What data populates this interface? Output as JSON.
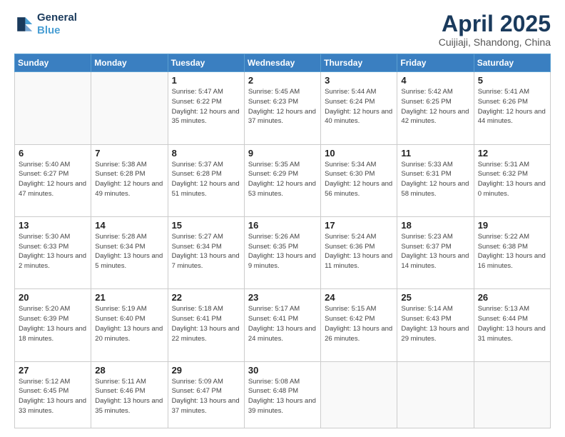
{
  "logo": {
    "line1": "General",
    "line2": "Blue"
  },
  "title": "April 2025",
  "location": "Cuijiaji, Shandong, China",
  "days_of_week": [
    "Sunday",
    "Monday",
    "Tuesday",
    "Wednesday",
    "Thursday",
    "Friday",
    "Saturday"
  ],
  "weeks": [
    [
      {
        "day": "",
        "empty": true
      },
      {
        "day": "",
        "empty": true
      },
      {
        "day": "1",
        "sunrise": "5:47 AM",
        "sunset": "6:22 PM",
        "daylight": "12 hours and 35 minutes."
      },
      {
        "day": "2",
        "sunrise": "5:45 AM",
        "sunset": "6:23 PM",
        "daylight": "12 hours and 37 minutes."
      },
      {
        "day": "3",
        "sunrise": "5:44 AM",
        "sunset": "6:24 PM",
        "daylight": "12 hours and 40 minutes."
      },
      {
        "day": "4",
        "sunrise": "5:42 AM",
        "sunset": "6:25 PM",
        "daylight": "12 hours and 42 minutes."
      },
      {
        "day": "5",
        "sunrise": "5:41 AM",
        "sunset": "6:26 PM",
        "daylight": "12 hours and 44 minutes."
      }
    ],
    [
      {
        "day": "6",
        "sunrise": "5:40 AM",
        "sunset": "6:27 PM",
        "daylight": "12 hours and 47 minutes."
      },
      {
        "day": "7",
        "sunrise": "5:38 AM",
        "sunset": "6:28 PM",
        "daylight": "12 hours and 49 minutes."
      },
      {
        "day": "8",
        "sunrise": "5:37 AM",
        "sunset": "6:28 PM",
        "daylight": "12 hours and 51 minutes."
      },
      {
        "day": "9",
        "sunrise": "5:35 AM",
        "sunset": "6:29 PM",
        "daylight": "12 hours and 53 minutes."
      },
      {
        "day": "10",
        "sunrise": "5:34 AM",
        "sunset": "6:30 PM",
        "daylight": "12 hours and 56 minutes."
      },
      {
        "day": "11",
        "sunrise": "5:33 AM",
        "sunset": "6:31 PM",
        "daylight": "12 hours and 58 minutes."
      },
      {
        "day": "12",
        "sunrise": "5:31 AM",
        "sunset": "6:32 PM",
        "daylight": "13 hours and 0 minutes."
      }
    ],
    [
      {
        "day": "13",
        "sunrise": "5:30 AM",
        "sunset": "6:33 PM",
        "daylight": "13 hours and 2 minutes."
      },
      {
        "day": "14",
        "sunrise": "5:28 AM",
        "sunset": "6:34 PM",
        "daylight": "13 hours and 5 minutes."
      },
      {
        "day": "15",
        "sunrise": "5:27 AM",
        "sunset": "6:34 PM",
        "daylight": "13 hours and 7 minutes."
      },
      {
        "day": "16",
        "sunrise": "5:26 AM",
        "sunset": "6:35 PM",
        "daylight": "13 hours and 9 minutes."
      },
      {
        "day": "17",
        "sunrise": "5:24 AM",
        "sunset": "6:36 PM",
        "daylight": "13 hours and 11 minutes."
      },
      {
        "day": "18",
        "sunrise": "5:23 AM",
        "sunset": "6:37 PM",
        "daylight": "13 hours and 14 minutes."
      },
      {
        "day": "19",
        "sunrise": "5:22 AM",
        "sunset": "6:38 PM",
        "daylight": "13 hours and 16 minutes."
      }
    ],
    [
      {
        "day": "20",
        "sunrise": "5:20 AM",
        "sunset": "6:39 PM",
        "daylight": "13 hours and 18 minutes."
      },
      {
        "day": "21",
        "sunrise": "5:19 AM",
        "sunset": "6:40 PM",
        "daylight": "13 hours and 20 minutes."
      },
      {
        "day": "22",
        "sunrise": "5:18 AM",
        "sunset": "6:41 PM",
        "daylight": "13 hours and 22 minutes."
      },
      {
        "day": "23",
        "sunrise": "5:17 AM",
        "sunset": "6:41 PM",
        "daylight": "13 hours and 24 minutes."
      },
      {
        "day": "24",
        "sunrise": "5:15 AM",
        "sunset": "6:42 PM",
        "daylight": "13 hours and 26 minutes."
      },
      {
        "day": "25",
        "sunrise": "5:14 AM",
        "sunset": "6:43 PM",
        "daylight": "13 hours and 29 minutes."
      },
      {
        "day": "26",
        "sunrise": "5:13 AM",
        "sunset": "6:44 PM",
        "daylight": "13 hours and 31 minutes."
      }
    ],
    [
      {
        "day": "27",
        "sunrise": "5:12 AM",
        "sunset": "6:45 PM",
        "daylight": "13 hours and 33 minutes."
      },
      {
        "day": "28",
        "sunrise": "5:11 AM",
        "sunset": "6:46 PM",
        "daylight": "13 hours and 35 minutes."
      },
      {
        "day": "29",
        "sunrise": "5:09 AM",
        "sunset": "6:47 PM",
        "daylight": "13 hours and 37 minutes."
      },
      {
        "day": "30",
        "sunrise": "5:08 AM",
        "sunset": "6:48 PM",
        "daylight": "13 hours and 39 minutes."
      },
      {
        "day": "",
        "empty": true
      },
      {
        "day": "",
        "empty": true
      },
      {
        "day": "",
        "empty": true
      }
    ]
  ]
}
